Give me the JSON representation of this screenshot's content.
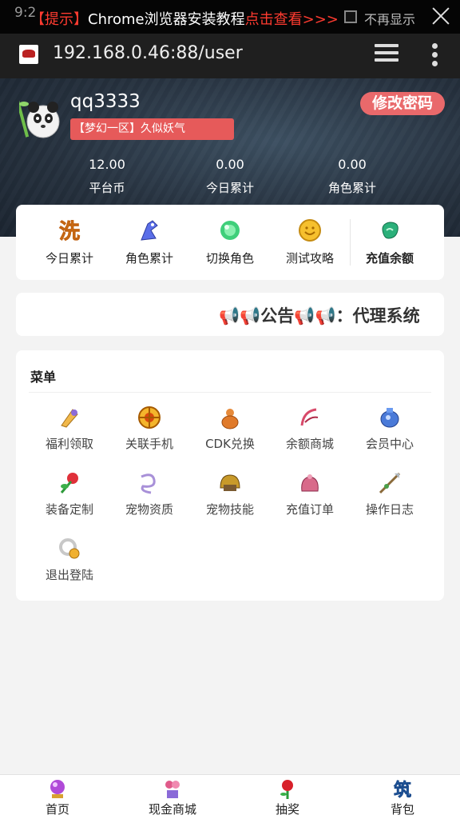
{
  "status_bar": {
    "time": "9:2",
    "notice_prefix": "【提示】",
    "notice_main": "Chrome浏览器安装教程",
    "notice_link": "点击查看>>>",
    "hide_label": "不再显示"
  },
  "browser": {
    "url": "192.168.0.46:88/user"
  },
  "profile": {
    "username": "qq3333",
    "server": "【梦幻一区】久似妖气",
    "change_password": "修改密码",
    "stats": [
      {
        "value": "12.00",
        "label": "平台币"
      },
      {
        "value": "0.00",
        "label": "今日累计"
      },
      {
        "value": "0.00",
        "label": "角色累计"
      }
    ]
  },
  "quick_actions": [
    {
      "label": "今日累计",
      "icon": "wash-character-icon"
    },
    {
      "label": "角色累计",
      "icon": "blue-dragon-icon"
    },
    {
      "label": "切换角色",
      "icon": "green-orb-icon"
    },
    {
      "label": "测试攻略",
      "icon": "gold-coin-icon"
    },
    {
      "label": "充值余额",
      "icon": "jade-icon"
    }
  ],
  "announcement": {
    "text": "📢📢公告📢📢：代理系统"
  },
  "menu": {
    "title": "菜单",
    "items": [
      {
        "label": "福利领取",
        "icon": "gift-icon"
      },
      {
        "label": "关联手机",
        "icon": "wheel-icon"
      },
      {
        "label": "CDK兑换",
        "icon": "gourd-icon"
      },
      {
        "label": "余额商城",
        "icon": "fan-icon"
      },
      {
        "label": "会员中心",
        "icon": "vase-icon"
      },
      {
        "label": "装备定制",
        "icon": "flower-icon"
      },
      {
        "label": "宠物资质",
        "icon": "ribbon-icon"
      },
      {
        "label": "宠物技能",
        "icon": "helmet-icon"
      },
      {
        "label": "充值订单",
        "icon": "bag-icon"
      },
      {
        "label": "操作日志",
        "icon": "spear-icon"
      },
      {
        "label": "退出登陆",
        "icon": "ring-icon"
      }
    ]
  },
  "bottom_nav": [
    {
      "label": "首页",
      "icon": "crystal-ball-icon"
    },
    {
      "label": "现金商城",
      "icon": "flower-pot-icon"
    },
    {
      "label": "抽奖",
      "icon": "rose-icon"
    },
    {
      "label": "背包",
      "icon": "backpack-icon"
    }
  ],
  "colors": {
    "accent_red": "#e65a5a",
    "button_pink": "#e9696b",
    "header_bg": "#25303d",
    "notice_red": "#ff3b30"
  }
}
